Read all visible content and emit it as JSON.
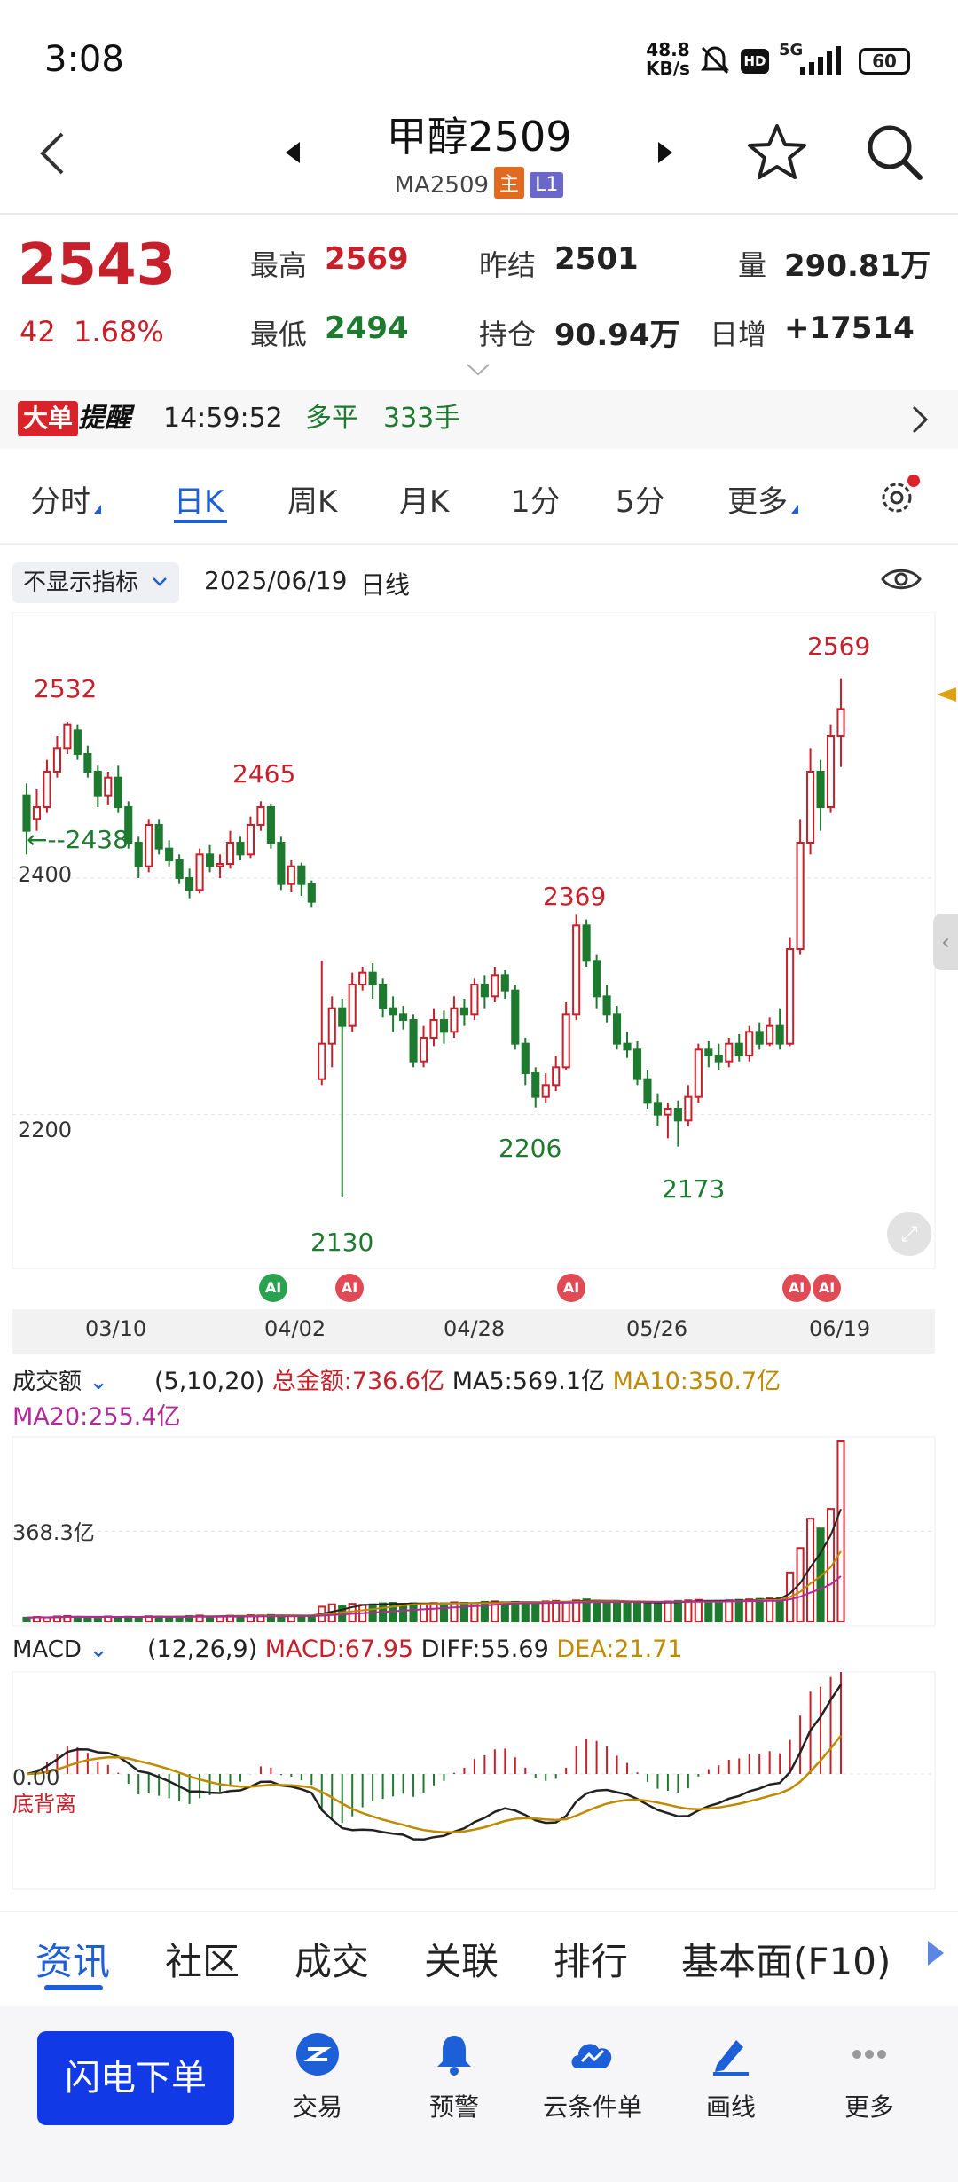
{
  "status_bar": {
    "time": "3:08",
    "net_speed": "48.8",
    "net_unit": "KB/s",
    "hd": "HD",
    "signal": "5G",
    "battery": "60"
  },
  "header": {
    "title": "甲醇2509",
    "code": "MA2509",
    "tag_main": "主",
    "tag_level": "L1"
  },
  "quote": {
    "price": "2543",
    "change": "42",
    "change_pct": "1.68%",
    "high_label": "最高",
    "high": "2569",
    "low_label": "最低",
    "low": "2494",
    "prev_settle_label": "昨结",
    "prev_settle": "2501",
    "open_interest_label": "持仓",
    "open_interest": "90.94万",
    "volume_label": "量",
    "volume": "290.81万",
    "daily_inc_label": "日增",
    "daily_inc": "+17514"
  },
  "alert": {
    "badge": "大单",
    "title": "提醒",
    "time": "14:59:52",
    "type": "多平",
    "qty": "333手"
  },
  "period_tabs": [
    "分时",
    "日K",
    "周K",
    "月K",
    "1分",
    "5分",
    "更多"
  ],
  "active_period": "日K",
  "indicator_bar": {
    "dropdown": "不显示指标",
    "date": "2025/06/19",
    "type": "日线"
  },
  "chart_data": [
    {
      "type": "candlestick",
      "axis_labels": [
        "2400",
        "2200"
      ],
      "ylim": [
        2100,
        2580
      ],
      "price_annotations": [
        "2532",
        "2465",
        "2438",
        "2369",
        "2206",
        "2173",
        "2130",
        "2569"
      ],
      "x_labels": [
        "03/10",
        "04/02",
        "04/28",
        "05/26",
        "06/19"
      ],
      "ai_markers": 5,
      "candles": [
        [
          2470,
          2440,
          2480,
          2420
        ],
        [
          2450,
          2460,
          2475,
          2440
        ],
        [
          2460,
          2490,
          2500,
          2455
        ],
        [
          2490,
          2510,
          2520,
          2485
        ],
        [
          2510,
          2530,
          2532,
          2505
        ],
        [
          2525,
          2505,
          2530,
          2500
        ],
        [
          2505,
          2490,
          2512,
          2485
        ],
        [
          2490,
          2470,
          2495,
          2460
        ],
        [
          2470,
          2485,
          2490,
          2462
        ],
        [
          2485,
          2460,
          2495,
          2455
        ],
        [
          2460,
          2430,
          2465,
          2425
        ],
        [
          2430,
          2410,
          2435,
          2400
        ],
        [
          2410,
          2445,
          2450,
          2405
        ],
        [
          2445,
          2425,
          2450,
          2420
        ],
        [
          2425,
          2415,
          2432,
          2410
        ],
        [
          2415,
          2400,
          2420,
          2395
        ],
        [
          2400,
          2390,
          2408,
          2383
        ],
        [
          2390,
          2420,
          2425,
          2387
        ],
        [
          2420,
          2410,
          2428,
          2405
        ],
        [
          2410,
          2412,
          2420,
          2400
        ],
        [
          2412,
          2430,
          2440,
          2408
        ],
        [
          2430,
          2420,
          2435,
          2415
        ],
        [
          2420,
          2445,
          2452,
          2417
        ],
        [
          2445,
          2460,
          2465,
          2440
        ],
        [
          2460,
          2430,
          2463,
          2425
        ],
        [
          2430,
          2395,
          2435,
          2390
        ],
        [
          2395,
          2410,
          2415,
          2388
        ],
        [
          2410,
          2395,
          2413,
          2385
        ],
        [
          2395,
          2380,
          2398,
          2375
        ],
        [
          2230,
          2260,
          2330,
          2225
        ],
        [
          2260,
          2290,
          2300,
          2240
        ],
        [
          2290,
          2275,
          2298,
          2130
        ],
        [
          2275,
          2310,
          2320,
          2270
        ],
        [
          2310,
          2320,
          2325,
          2305
        ],
        [
          2320,
          2310,
          2328,
          2298
        ],
        [
          2310,
          2290,
          2315,
          2282
        ],
        [
          2290,
          2285,
          2300,
          2270
        ],
        [
          2285,
          2280,
          2292,
          2272
        ],
        [
          2280,
          2245,
          2285,
          2240
        ],
        [
          2245,
          2265,
          2275,
          2240
        ],
        [
          2265,
          2280,
          2290,
          2258
        ],
        [
          2280,
          2270,
          2288,
          2260
        ],
        [
          2270,
          2290,
          2300,
          2265
        ],
        [
          2290,
          2285,
          2298,
          2275
        ],
        [
          2285,
          2310,
          2315,
          2280
        ],
        [
          2310,
          2300,
          2318,
          2290
        ],
        [
          2300,
          2318,
          2325,
          2295
        ],
        [
          2318,
          2305,
          2322,
          2298
        ],
        [
          2305,
          2260,
          2310,
          2255
        ],
        [
          2260,
          2235,
          2265,
          2225
        ],
        [
          2235,
          2215,
          2240,
          2206
        ],
        [
          2215,
          2225,
          2235,
          2210
        ],
        [
          2225,
          2240,
          2250,
          2220
        ],
        [
          2240,
          2285,
          2295,
          2238
        ],
        [
          2285,
          2360,
          2369,
          2280
        ],
        [
          2360,
          2330,
          2365,
          2325
        ],
        [
          2330,
          2300,
          2335,
          2290
        ],
        [
          2300,
          2285,
          2310,
          2278
        ],
        [
          2285,
          2260,
          2292,
          2255
        ],
        [
          2260,
          2255,
          2270,
          2248
        ],
        [
          2255,
          2230,
          2262,
          2225
        ],
        [
          2230,
          2210,
          2238,
          2205
        ],
        [
          2210,
          2200,
          2218,
          2190
        ],
        [
          2200,
          2205,
          2210,
          2180
        ],
        [
          2205,
          2195,
          2212,
          2173
        ],
        [
          2195,
          2215,
          2225,
          2190
        ],
        [
          2215,
          2255,
          2260,
          2210
        ],
        [
          2255,
          2250,
          2262,
          2240
        ],
        [
          2250,
          2245,
          2260,
          2238
        ],
        [
          2245,
          2260,
          2265,
          2240
        ],
        [
          2260,
          2250,
          2268,
          2245
        ],
        [
          2250,
          2270,
          2275,
          2245
        ],
        [
          2270,
          2260,
          2278,
          2255
        ],
        [
          2260,
          2275,
          2282,
          2258
        ],
        [
          2275,
          2260,
          2290,
          2255
        ],
        [
          2260,
          2340,
          2350,
          2258
        ],
        [
          2340,
          2430,
          2450,
          2335
        ],
        [
          2430,
          2490,
          2510,
          2420
        ],
        [
          2490,
          2460,
          2500,
          2440
        ],
        [
          2460,
          2520,
          2530,
          2455
        ],
        [
          2520,
          2543,
          2569,
          2494
        ]
      ]
    },
    {
      "type": "bar",
      "title": "成交额",
      "params": "(5,10,20)",
      "total_label": "总金额:736.6亿",
      "ma5_label": "MA5:569.1亿",
      "ma10_label": "MA10:350.7亿",
      "ma20_label": "MA20:255.4亿",
      "axis_label": "368.3亿",
      "values_yi": [
        15,
        18,
        16,
        20,
        22,
        18,
        17,
        16,
        20,
        18,
        19,
        17,
        21,
        20,
        18,
        19,
        22,
        24,
        20,
        21,
        23,
        22,
        25,
        24,
        26,
        24,
        23,
        22,
        24,
        60,
        70,
        65,
        72,
        68,
        70,
        74,
        76,
        72,
        74,
        70,
        75,
        74,
        78,
        76,
        74,
        80,
        82,
        78,
        80,
        76,
        78,
        82,
        84,
        80,
        86,
        90,
        84,
        82,
        80,
        78,
        76,
        74,
        78,
        82,
        84,
        86,
        88,
        80,
        84,
        86,
        88,
        90,
        92,
        94,
        96,
        200,
        300,
        420,
        380,
        460,
        736
      ]
    },
    {
      "type": "bar",
      "title": "MACD",
      "params": "(12,26,9)",
      "macd_label": "MACD:67.95",
      "diff_label": "DIFF:55.69",
      "dea_label": "DEA:21.71",
      "zero_label": "0.00",
      "note": "底背离"
    }
  ],
  "bottom_tabs": [
    "资讯",
    "社区",
    "成交",
    "关联",
    "排行",
    "基本面(F10)"
  ],
  "active_bottom_tab": "资讯",
  "bottom_nav": {
    "primary": "闪电下单",
    "items": [
      "交易",
      "预警",
      "云条件单",
      "画线",
      "更多"
    ]
  },
  "colors": {
    "up": "#c8202a",
    "down": "#1d7a2e",
    "accent": "#1d5fd6",
    "primary_button": "#1239e6"
  }
}
